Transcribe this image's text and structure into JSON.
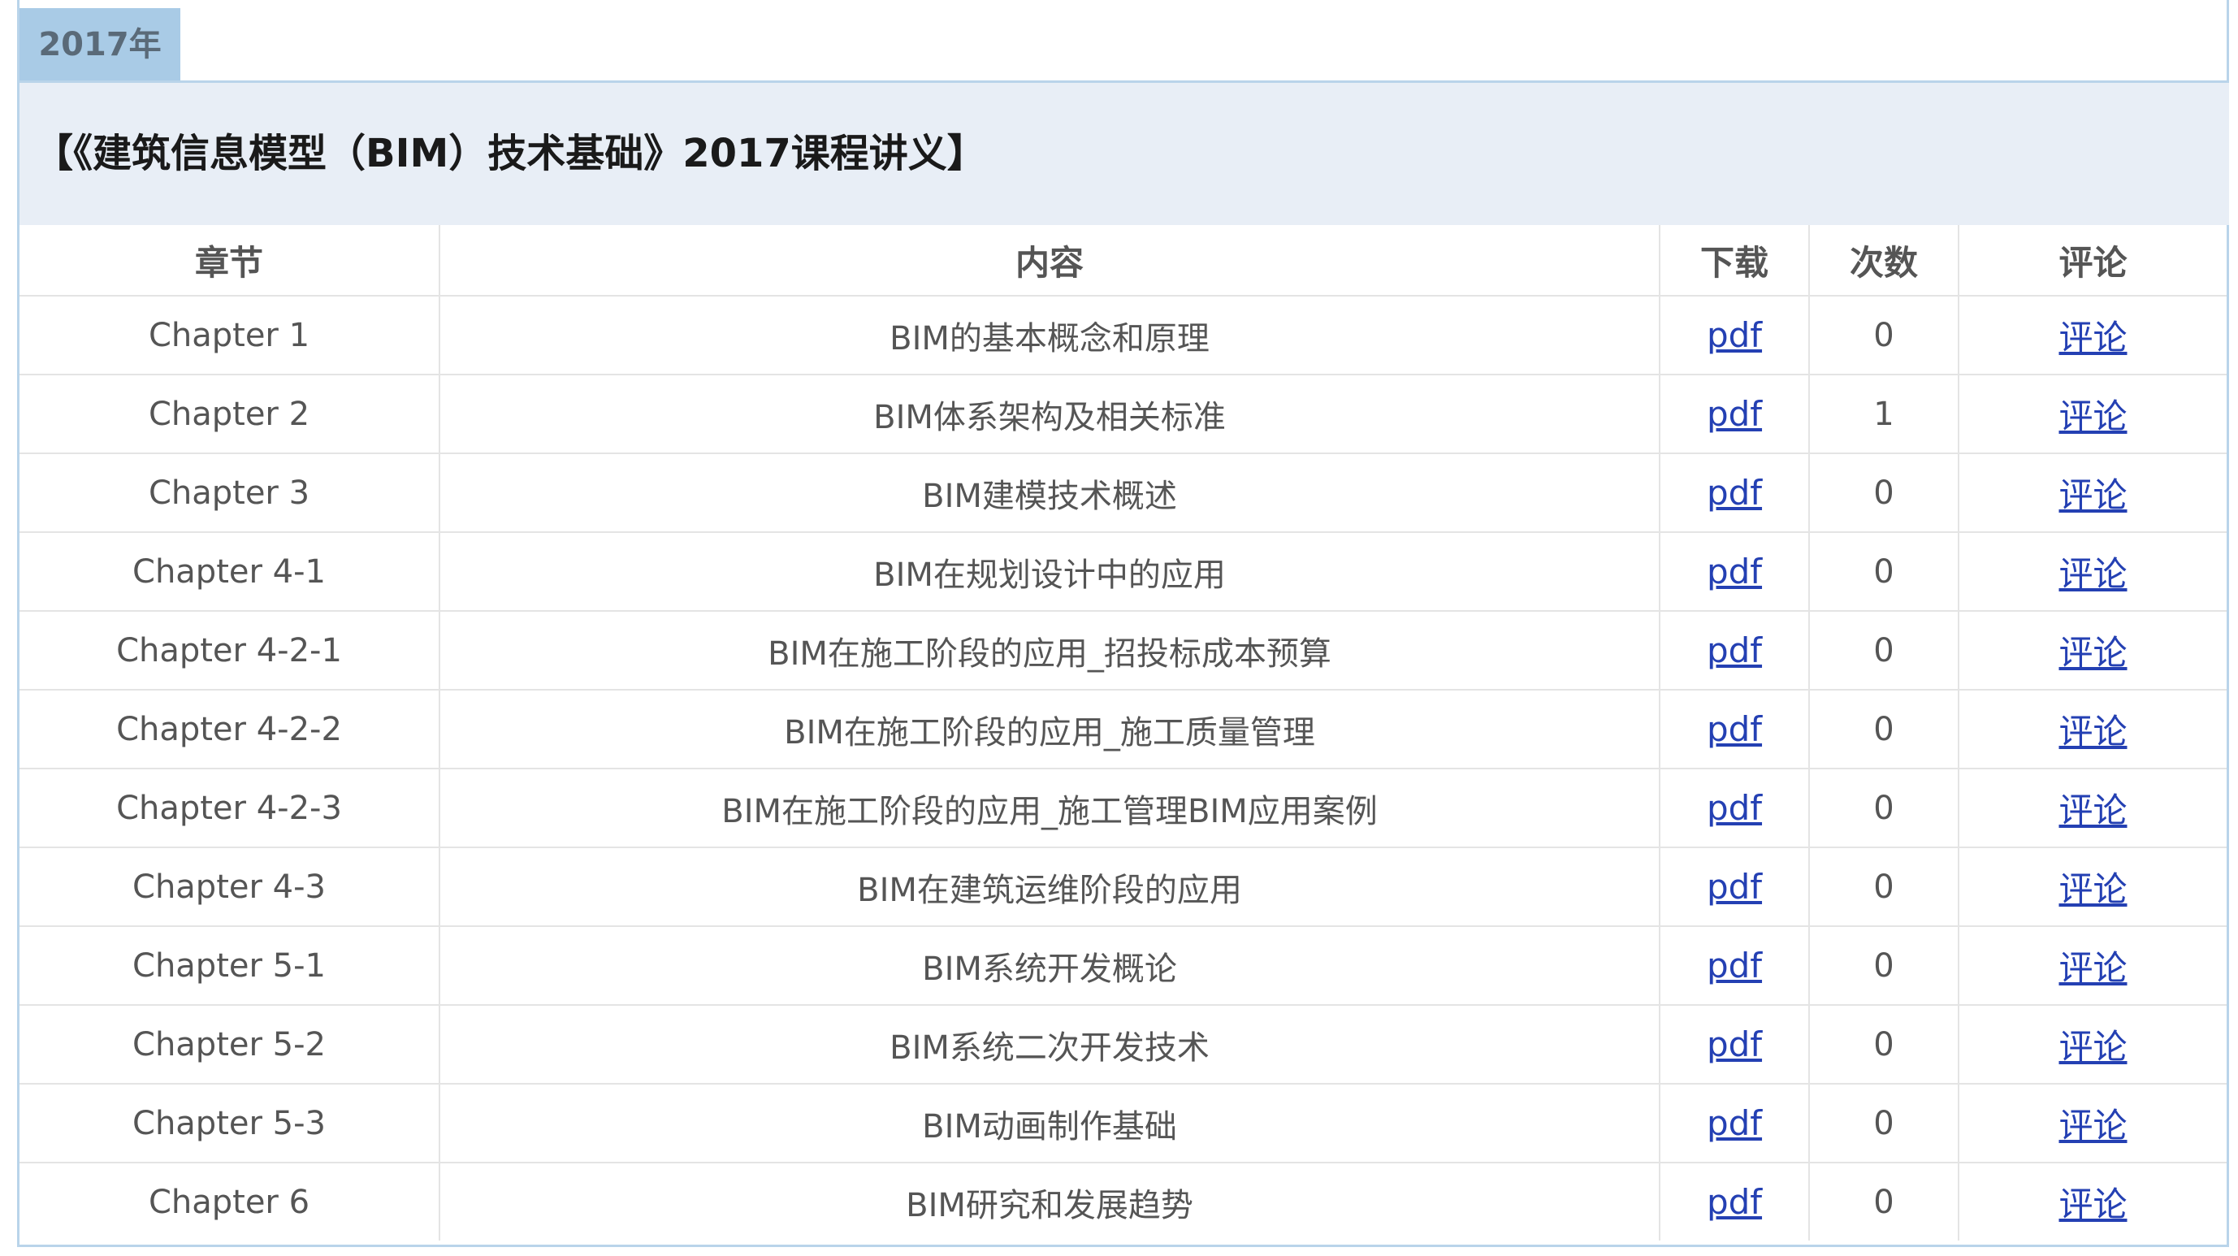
{
  "year_tab": "2017年",
  "course_title": "【《建筑信息模型（BIM）技术基础》2017课程讲义】",
  "columns": {
    "chapter": "章节",
    "content": "内容",
    "download": "下载",
    "count": "次数",
    "comment": "评论"
  },
  "rows": [
    {
      "chapter": "Chapter 1",
      "content": "BIM的基本概念和原理",
      "download": "pdf",
      "count": "0",
      "comment": "评论"
    },
    {
      "chapter": "Chapter 2",
      "content": "BIM体系架构及相关标准",
      "download": "pdf",
      "count": "1",
      "comment": "评论"
    },
    {
      "chapter": "Chapter 3",
      "content": "BIM建模技术概述",
      "download": "pdf",
      "count": "0",
      "comment": "评论"
    },
    {
      "chapter": "Chapter 4-1",
      "content": "BIM在规划设计中的应用",
      "download": "pdf",
      "count": "0",
      "comment": "评论"
    },
    {
      "chapter": "Chapter 4-2-1",
      "content": "BIM在施工阶段的应用_招投标成本预算",
      "download": "pdf",
      "count": "0",
      "comment": "评论"
    },
    {
      "chapter": "Chapter 4-2-2",
      "content": "BIM在施工阶段的应用_施工质量管理",
      "download": "pdf",
      "count": "0",
      "comment": "评论"
    },
    {
      "chapter": "Chapter 4-2-3",
      "content": "BIM在施工阶段的应用_施工管理BIM应用案例",
      "download": "pdf",
      "count": "0",
      "comment": "评论"
    },
    {
      "chapter": "Chapter 4-3",
      "content": "BIM在建筑运维阶段的应用",
      "download": "pdf",
      "count": "0",
      "comment": "评论"
    },
    {
      "chapter": "Chapter 5-1",
      "content": "BIM系统开发概论",
      "download": "pdf",
      "count": "0",
      "comment": "评论"
    },
    {
      "chapter": "Chapter 5-2",
      "content": "BIM系统二次开发技术",
      "download": "pdf",
      "count": "0",
      "comment": "评论"
    },
    {
      "chapter": "Chapter 5-3",
      "content": "BIM动画制作基础",
      "download": "pdf",
      "count": "0",
      "comment": "评论"
    },
    {
      "chapter": "Chapter 6",
      "content": "BIM研究和发展趋势",
      "download": "pdf",
      "count": "0",
      "comment": "评论"
    }
  ],
  "colors": {
    "tab_bg": "#a9cbe6",
    "header_bg": "#e8eef6",
    "border": "#b9d4ea",
    "link": "#2440b3"
  }
}
